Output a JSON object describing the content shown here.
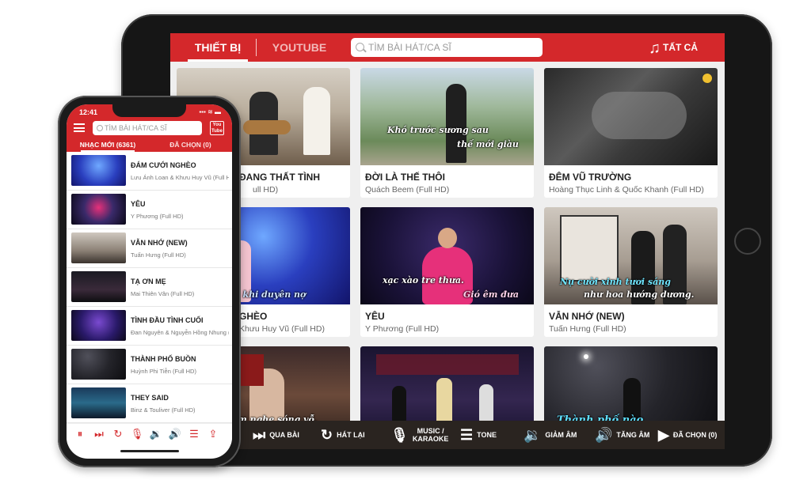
{
  "tablet": {
    "tabs": {
      "active": "THIẾT BỊ",
      "youtube": "YOUTUBE"
    },
    "search_placeholder": "TÌM BÀI HÁT/CA SĨ",
    "all_label": "TẤT CẢ",
    "cards": [
      {
        "title": "ĐANG THẤT TÌNH",
        "sub": "ull HD)",
        "cap1": "",
        "cap2": ""
      },
      {
        "title": "ĐỜI LÀ THẾ THÔI",
        "sub": "Quách Beem (Full HD)",
        "cap1": "Khó trước sương sau",
        "cap2": "thế mới giàu"
      },
      {
        "title": "ĐÊM VŨ TRƯỜNG",
        "sub": "Hoàng Thục Linh & Quốc Khanh (Full HD)",
        "cap1": "",
        "cap2": ""
      },
      {
        "title": "GHÈO",
        "sub": "Khưu Huy Vũ (Full HD)",
        "cap1": "nhưng khi duyên nợ",
        "cap2": ""
      },
      {
        "title": "YÊU",
        "sub": "Y Phương (Full HD)",
        "cap1": "xạc xào tre thưa.",
        "cap2": "Gió êm đưa"
      },
      {
        "title": "VẪN NHỚ (NEW)",
        "sub": "Tuấn Hưng (Full HD)",
        "cap1": "Nụ cười xinh tươi sáng",
        "cap2": "như hoa hướng dương."
      },
      {
        "title": "",
        "sub": "",
        "cap1": "ằm nghe sóng vỗ,",
        "cap2": ""
      },
      {
        "title": "",
        "sub": "",
        "cap1": "",
        "cap2": ""
      },
      {
        "title": "",
        "sub": "",
        "cap1": "",
        "cap2": "Thành phố nào"
      }
    ],
    "controls": {
      "next": "QUA BÀI",
      "replay": "HÁT LẠI",
      "music1": "MUSIC /",
      "music2": "KARAOKE",
      "tone": "TONE",
      "vol_down": "GIẢM ÂM",
      "vol_up": "TĂNG ÂM",
      "selected": "ĐÃ CHỌN (0)"
    }
  },
  "phone": {
    "time": "12:41",
    "status": "▪▪▪ ≋ ▬",
    "search_placeholder": "TÌM BÀI HÁT/CA SĨ",
    "youtube_l1": "You",
    "youtube_l2": "Tube",
    "tabs": {
      "new": "NHẠC MỚI (6361)",
      "selected": "ĐÃ CHỌN (0)"
    },
    "items": [
      {
        "title": "ĐÁM CƯỚI NGHÈO",
        "sub": "Lưu Ánh Loan & Khưu Huy Vũ (Full HD)"
      },
      {
        "title": "YÊU",
        "sub": "Y Phương (Full HD)"
      },
      {
        "title": "VẪN NHỚ (NEW)",
        "sub": "Tuấn Hưng (Full HD)"
      },
      {
        "title": "TẠ ƠN MẸ",
        "sub": "Mai Thiên Vân (Full HD)"
      },
      {
        "title": "TÌNH ĐẦU TÌNH CUỐI",
        "sub": "Đan Nguyên & Nguyễn Hồng Nhung (Full HD)"
      },
      {
        "title": "THÀNH PHỐ BUỒN",
        "sub": "Huỳnh Phi Tiễn (Full HD)"
      },
      {
        "title": "THEY SAID",
        "sub": "Binz & Touliver (Full HD)"
      }
    ]
  }
}
